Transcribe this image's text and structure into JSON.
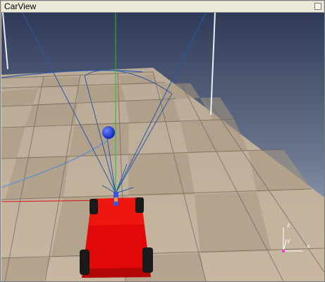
{
  "window": {
    "title": "CarView"
  },
  "axes_gizmo": {
    "z_label": "z",
    "y_label": "y",
    "x_label": "x"
  },
  "colors": {
    "sky_top": "#3e4a66",
    "sky_bottom": "#b7c0ce",
    "floor_light": "#c9b9a3",
    "floor_dark": "#a8957b",
    "grid_line": "#6e6256",
    "car_body": "#e00808",
    "wheel": "#1a1a1a",
    "ball": "#1f3ad4",
    "green_axis": "#22c022",
    "red_axis": "#d21a1a",
    "blue_line": "#2a58a8"
  },
  "icons": {
    "close": "close-icon"
  }
}
